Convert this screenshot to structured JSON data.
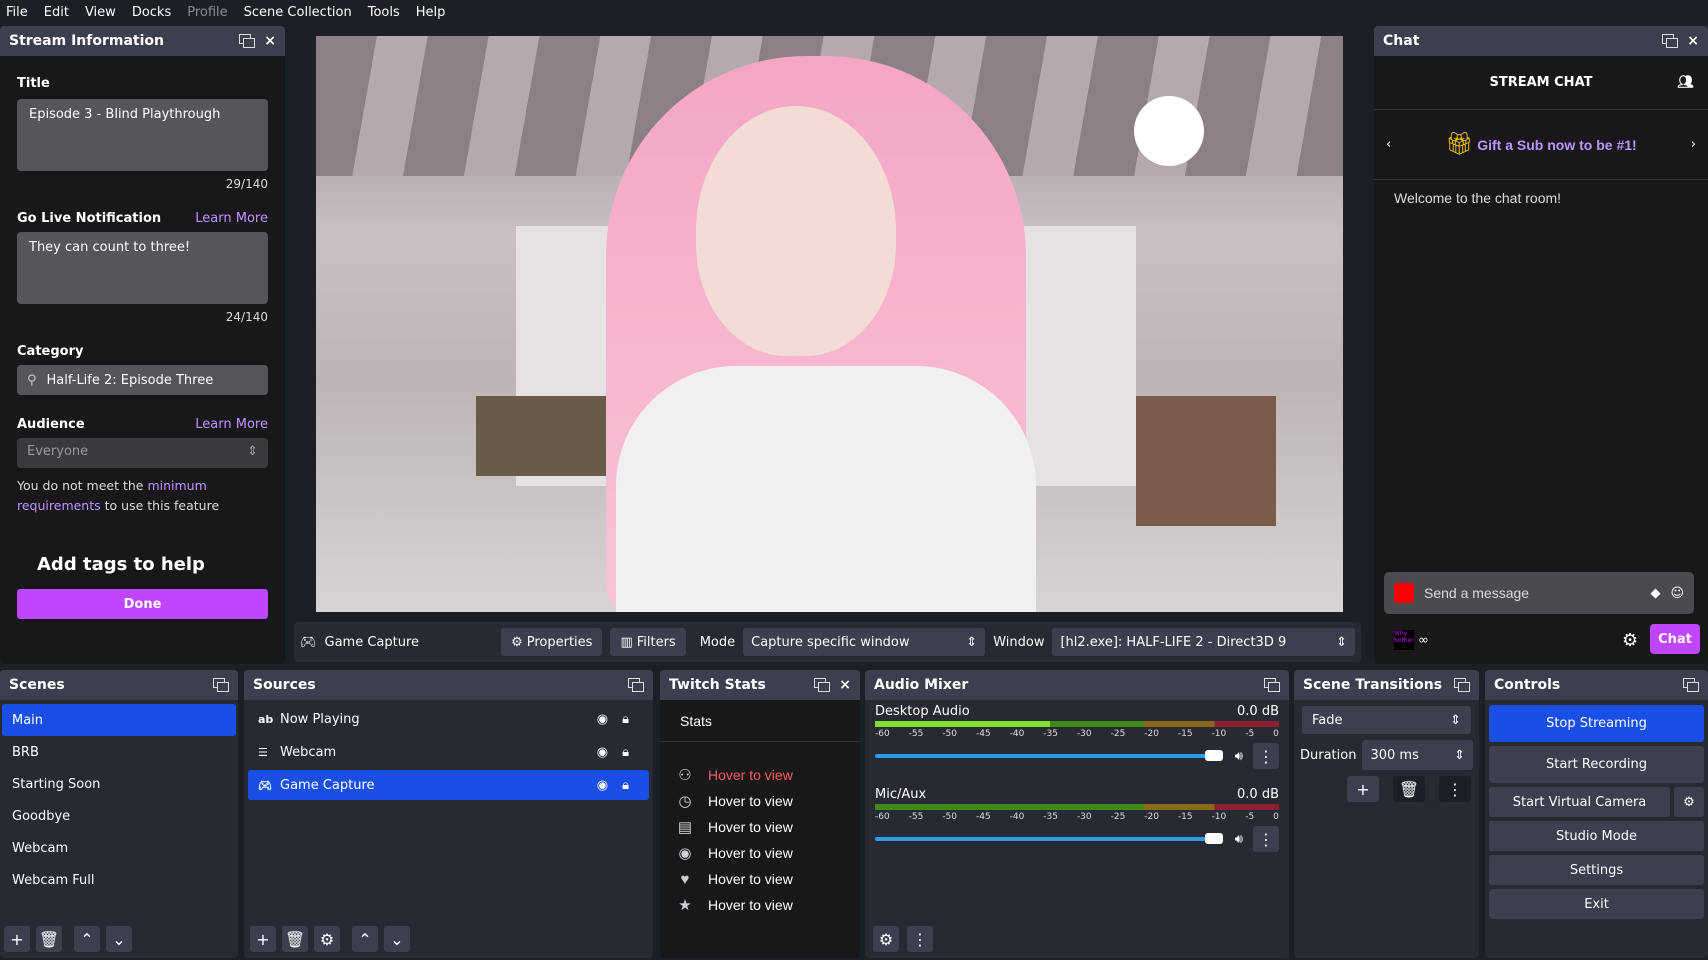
{
  "menu": [
    "File",
    "Edit",
    "View",
    "Docks",
    "Profile",
    "Scene Collection",
    "Tools",
    "Help"
  ],
  "stream_info": {
    "header": "Stream Information",
    "title_label": "Title",
    "title_value": "Episode 3 - Blind Playthrough",
    "title_count": "29/140",
    "notif_label": "Go Live Notification",
    "learn_more": "Learn More",
    "notif_value": "They can count to three!",
    "notif_count": "24/140",
    "category_label": "Category",
    "category_value": "Half-Life 2: Episode Three",
    "audience_label": "Audience",
    "audience_value": "Everyone",
    "req_1": "You do not meet the ",
    "req_link_1": "minimum",
    "req_link_2": "requirements",
    "req_2": " to use this feature",
    "tags_heading": "Add tags to help",
    "done": "Done"
  },
  "source_toolbar": {
    "source": "Game Capture",
    "properties": "Properties",
    "filters": "Filters",
    "mode_label": "Mode",
    "mode_value": "Capture specific window",
    "window_label": "Window",
    "window_value": "[hl2.exe]: HALF-LIFE 2 - Direct3D 9"
  },
  "chat": {
    "header": "Chat",
    "title": "STREAM CHAT",
    "gift": "Gift a Sub now to be #1!",
    "welcome": "Welcome to the chat room!",
    "placeholder": "Send a message",
    "badge": "Why bother",
    "infinity": "∞",
    "chat_button": "Chat"
  },
  "scenes": {
    "header": "Scenes",
    "items": [
      "Main",
      "BRB",
      "Starting Soon",
      "Goodbye",
      "Webcam",
      "Webcam Full"
    ],
    "selected": "Main"
  },
  "sources": {
    "header": "Sources",
    "items": [
      {
        "icon": "text-icon",
        "name": "Now Playing"
      },
      {
        "icon": "list-icon",
        "name": "Webcam"
      },
      {
        "icon": "gamepad-icon",
        "name": "Game Capture"
      }
    ],
    "selected": "Game Capture"
  },
  "twitch_stats": {
    "header": "Twitch Stats",
    "tab": "Stats",
    "items": [
      {
        "icon": "user-icon",
        "text": "Hover to view",
        "color": "#ff5a5f"
      },
      {
        "icon": "clock-icon",
        "text": "Hover to view"
      },
      {
        "icon": "clapper-icon",
        "text": "Hover to view"
      },
      {
        "icon": "eye-icon",
        "text": "Hover to view"
      },
      {
        "icon": "heart-icon",
        "text": "Hover to view"
      },
      {
        "icon": "star-icon",
        "text": "Hover to view"
      }
    ]
  },
  "audio_mixer": {
    "header": "Audio Mixer",
    "ticks": [
      "-60",
      "-55",
      "-50",
      "-45",
      "-40",
      "-35",
      "-30",
      "-25",
      "-20",
      "-15",
      "-10",
      "-5",
      "0"
    ],
    "channels": [
      {
        "name": "Desktop Audio",
        "db": "0.0 dB",
        "volume_percent": 100,
        "level_db": -34
      },
      {
        "name": "Mic/Aux",
        "db": "0.0 dB",
        "volume_percent": 100,
        "level_db": -60
      }
    ]
  },
  "transitions": {
    "header": "Scene Transitions",
    "type": "Fade",
    "duration_label": "Duration",
    "duration": "300 ms"
  },
  "controls": {
    "header": "Controls",
    "stop_streaming": "Stop Streaming",
    "start_recording": "Start Recording",
    "virtual_camera": "Start Virtual Camera",
    "studio_mode": "Studio Mode",
    "settings": "Settings",
    "exit": "Exit"
  },
  "colors": {
    "accent": "#1a4fe6",
    "twitch_purple": "#bf45ff",
    "link": "#bf94ff"
  }
}
